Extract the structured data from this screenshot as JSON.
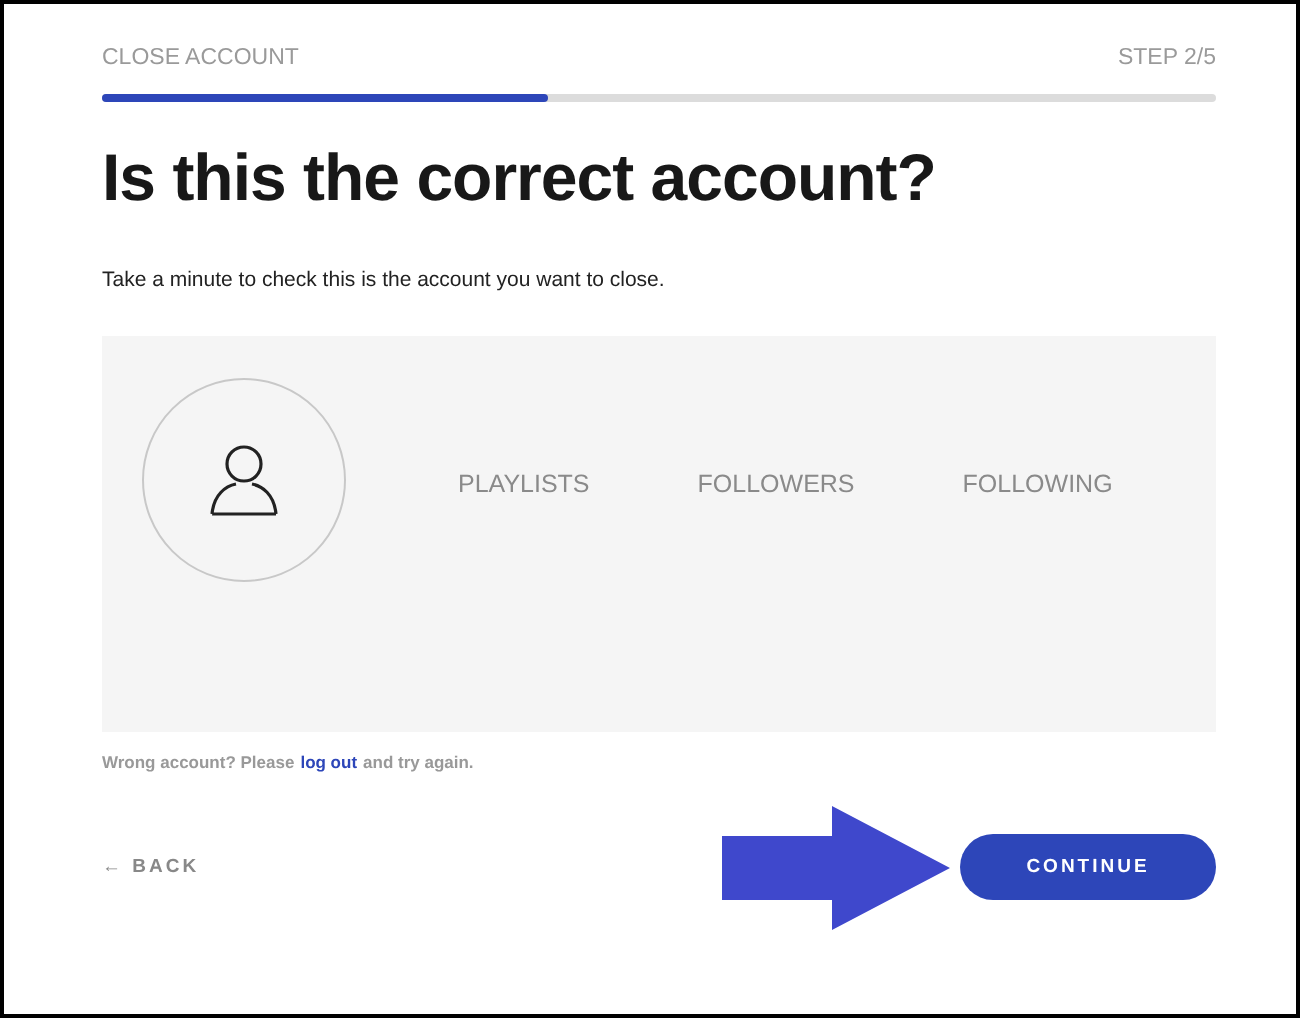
{
  "header": {
    "title": "CLOSE ACCOUNT",
    "step": "STEP 2/5"
  },
  "progress": {
    "level": 0.4
  },
  "heading": "Is this the correct account?",
  "intro": "Take a minute to check this is the account you want to close.",
  "account": {
    "stats": [
      {
        "label": "PLAYLISTS"
      },
      {
        "label": "FOLLOWERS"
      },
      {
        "label": "FOLLOWING"
      }
    ]
  },
  "wrong_account": {
    "prefix": "Wrong account? Please",
    "link": "log out",
    "suffix": "and try again."
  },
  "buttons": {
    "back": "← BACK",
    "continue": "CONTINUE"
  }
}
